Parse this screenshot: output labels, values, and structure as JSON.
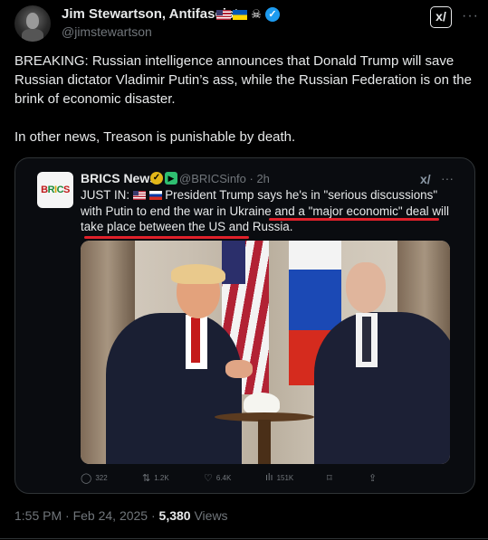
{
  "author": {
    "display_name": "Jim Stewartson, Antifascist",
    "handle": "@jimstewartson",
    "badges": [
      "us-flag-icon",
      "ukraine-flag-icon",
      "skull-crossbones-icon",
      "verified-icon"
    ]
  },
  "post": {
    "paragraphs": [
      "BREAKING: Russian intelligence announces that Donald Trump will save Russian dictator Vladimir Putin’s ass, while the Russian Federation is on the brink of economic disaster.",
      "In other news, Treason is punishable by death."
    ],
    "timestamp": "1:55 PM · Feb 24, 2025 · ",
    "views_count": "5,380",
    "views_label": " Views"
  },
  "quote": {
    "avatar_text": [
      "B",
      "R",
      "I",
      "C",
      "S"
    ],
    "display_name": "BRICS News",
    "handle_time": "@BRICSinfo · 2h",
    "text_prefix": "JUST IN: ",
    "text_body": " President Trump says he's in \"serious discussions\" with Putin to end the war in Ukraine and a \"major economic\" deal will take place between the US and Russia.",
    "stats": {
      "replies": "322",
      "reposts": "1.2K",
      "likes": "6.4K",
      "views": "151K"
    }
  },
  "colors": {
    "background": "#000000",
    "text": "#e7e9ea",
    "muted": "#71767b",
    "verified": "#1d9bf0",
    "annotation_red": "#e0202a"
  }
}
